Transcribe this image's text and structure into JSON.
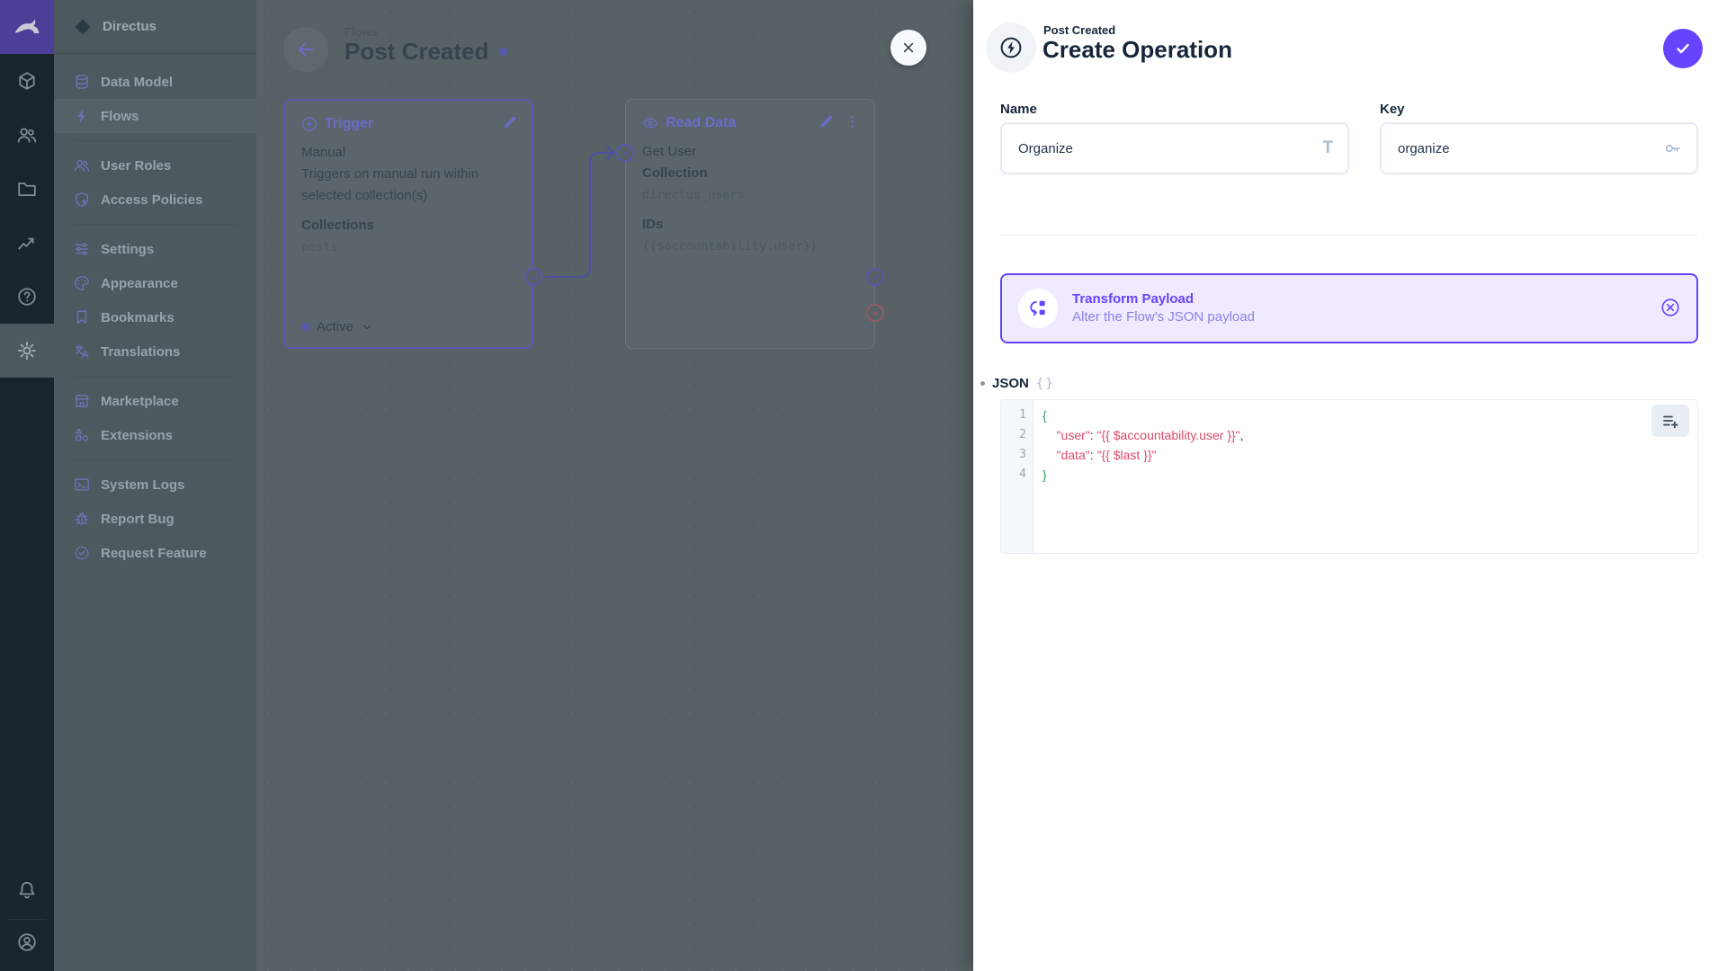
{
  "project": {
    "name": "Directus"
  },
  "module_bar": {
    "items": [
      {
        "icon": "cube",
        "name": "content",
        "active": false
      },
      {
        "icon": "users",
        "name": "user-directory",
        "active": false
      },
      {
        "icon": "folder",
        "name": "files",
        "active": false
      },
      {
        "icon": "chart",
        "name": "insights",
        "active": false
      },
      {
        "icon": "help",
        "name": "docs",
        "active": false
      },
      {
        "icon": "gear",
        "name": "settings",
        "active": true
      }
    ]
  },
  "nav": {
    "sections": [
      {
        "items": [
          {
            "label": "Data Model",
            "icon": "database",
            "active": false
          },
          {
            "label": "Flows",
            "icon": "bolt",
            "active": true
          }
        ]
      },
      {
        "items": [
          {
            "label": "User Roles",
            "icon": "users",
            "active": false
          },
          {
            "label": "Access Policies",
            "icon": "shield",
            "active": false
          }
        ]
      },
      {
        "items": [
          {
            "label": "Settings",
            "icon": "tune",
            "active": false
          },
          {
            "label": "Appearance",
            "icon": "palette",
            "active": false
          },
          {
            "label": "Bookmarks",
            "icon": "bookmark",
            "active": false
          },
          {
            "label": "Translations",
            "icon": "translate",
            "active": false
          }
        ]
      },
      {
        "items": [
          {
            "label": "Marketplace",
            "icon": "storefront",
            "active": false
          },
          {
            "label": "Extensions",
            "icon": "category",
            "active": false
          }
        ]
      },
      {
        "items": [
          {
            "label": "System Logs",
            "icon": "terminal",
            "active": false
          },
          {
            "label": "Report Bug",
            "icon": "bug",
            "active": false
          },
          {
            "label": "Request Feature",
            "icon": "verified",
            "active": false
          }
        ]
      }
    ]
  },
  "canvas": {
    "breadcrumb": "Flows",
    "title": "Post Created",
    "trigger": {
      "title": "Trigger",
      "line1": "Manual",
      "line2": "Triggers on manual run within selected collection(s)",
      "label1": "Collections",
      "value1": "posts",
      "status": "Active"
    },
    "read_data": {
      "title": "Read Data",
      "line1": "Get User",
      "label1": "Collection",
      "value1": "directus_users",
      "label2": "IDs",
      "value2": "{{$accountability.user}}"
    }
  },
  "drawer": {
    "subtitle": "Post Created",
    "title": "Create Operation",
    "name_field": {
      "label": "Name",
      "value": "Organize"
    },
    "key_field": {
      "label": "Key",
      "value": "organize"
    },
    "banner": {
      "title": "Transform Payload",
      "subtitle": "Alter the Flow's JSON payload"
    },
    "json_field": {
      "label": "JSON",
      "lines": [
        {
          "n": "1",
          "parts": [
            {
              "c": "brace",
              "t": "{"
            }
          ]
        },
        {
          "n": "2",
          "parts": [
            {
              "c": "str",
              "t": "    \"user\""
            },
            {
              "c": "pun",
              "t": ": "
            },
            {
              "c": "str",
              "t": "\"{{ $accountability.user }}\""
            },
            {
              "c": "pun",
              "t": ","
            }
          ]
        },
        {
          "n": "3",
          "parts": [
            {
              "c": "str",
              "t": "    \"data\""
            },
            {
              "c": "pun",
              "t": ": "
            },
            {
              "c": "str",
              "t": "\"{{ $last }}\""
            }
          ]
        },
        {
          "n": "4",
          "parts": [
            {
              "c": "brace",
              "t": "}"
            }
          ]
        }
      ]
    }
  },
  "colors": {
    "accent": "#6644ff",
    "code_string": "#dd4a68",
    "code_brace": "#2f9e62"
  }
}
